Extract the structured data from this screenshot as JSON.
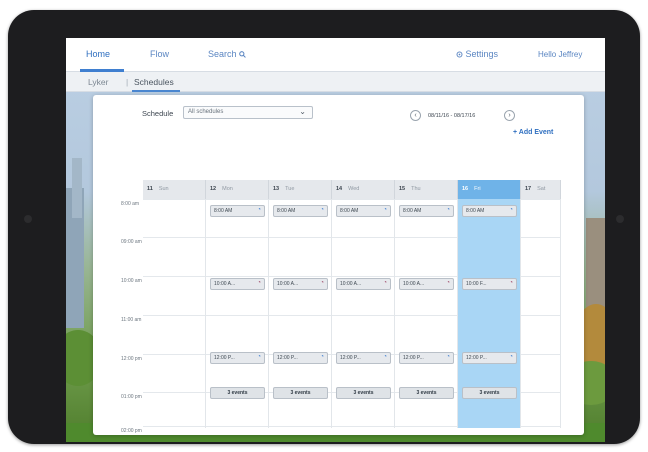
{
  "nav": {
    "items": [
      {
        "label": "Home",
        "active": true
      },
      {
        "label": "Flow"
      },
      {
        "label": "Search"
      }
    ],
    "search_icon": "search-icon",
    "settings_label": "Settings",
    "settings_icon": "gear-icon",
    "greeting": "Hello Jeffrey"
  },
  "breadcrumb": {
    "items": [
      "Lyker",
      "Schedules"
    ]
  },
  "toolbar": {
    "schedule_label": "Schedule",
    "schedule_value": "All schedules",
    "date_range": "08/11/16 - 08/17/16",
    "add_event_label": "+ Add Event"
  },
  "calendar": {
    "days": [
      {
        "num": "11",
        "name": "Sun"
      },
      {
        "num": "12",
        "name": "Mon"
      },
      {
        "num": "13",
        "name": "Tue"
      },
      {
        "num": "14",
        "name": "Wed"
      },
      {
        "num": "15",
        "name": "Thu"
      },
      {
        "num": "16",
        "name": "Fri",
        "today": true
      },
      {
        "num": "17",
        "name": "Sat"
      }
    ],
    "times": [
      "8:00 am",
      "09:00 am",
      "10:00 am",
      "11:00 am",
      "12:00 pm",
      "01:00 pm",
      "02:00 pm"
    ],
    "rows": [
      {
        "labels": [
          "",
          "8:00 AM",
          "8:00 AM",
          "8:00 AM",
          "8:00 AM",
          "8:00 AM",
          ""
        ]
      },
      {
        "labels": [
          "",
          "10:00 A...",
          "10:00 A...",
          "10:00 A...",
          "10:00 A...",
          "10:00 F...",
          ""
        ]
      },
      {
        "labels": [
          "",
          "12:00 P...",
          "12:00 P...",
          "12:00 P...",
          "12:00 P...",
          "12:00 P...",
          ""
        ]
      },
      {
        "labels": [
          "",
          "3 events",
          "3 events",
          "3 events",
          "3 events",
          "3 events",
          ""
        ]
      }
    ]
  },
  "colors": {
    "accent": "#3f7fd0",
    "today_column": "#a9d6f5",
    "tablet_frame": "#1d1d1f"
  }
}
